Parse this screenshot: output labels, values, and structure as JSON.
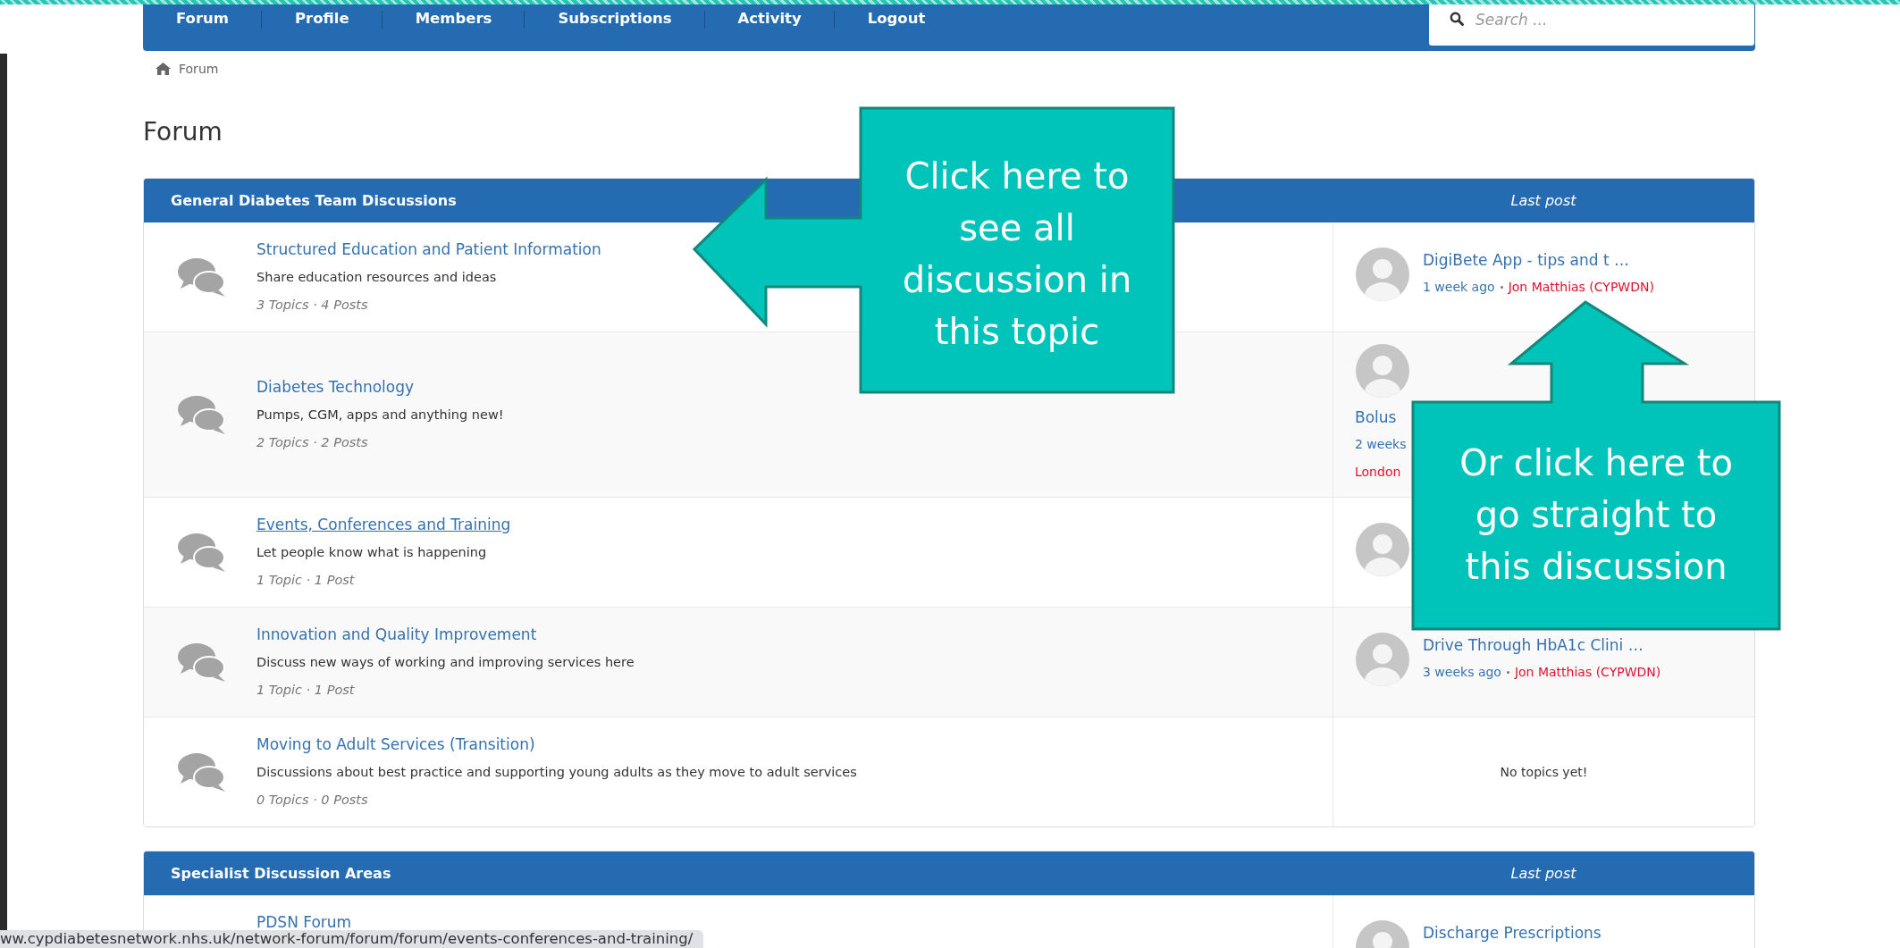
{
  "nav": {
    "items": [
      {
        "label": "Forum"
      },
      {
        "label": "Profile"
      },
      {
        "label": "Members"
      },
      {
        "label": "Subscriptions"
      },
      {
        "label": "Activity"
      },
      {
        "label": "Logout"
      }
    ],
    "search": {
      "placeholder": "Search ..."
    }
  },
  "breadcrumb": [
    {
      "label": "Forum"
    }
  ],
  "page_title": "Forum",
  "sections": [
    {
      "title": "General Diabetes Team Discussions",
      "last_post_heading": "Last post",
      "forums": [
        {
          "title": "Structured Education and Patient Information",
          "description": "Share education resources and ideas",
          "stats": "3 Topics · 4 Posts",
          "hovered": false,
          "last_post": {
            "kind": "post",
            "title": "DigiBete App - tips and t …",
            "time": "1 week ago",
            "author": "Jon Matthias (CYPWDN)"
          }
        },
        {
          "title": "Diabetes Technology",
          "description": "Pumps, CGM, apps and anything new!",
          "stats": "2 Topics · 2 Posts",
          "hovered": false,
          "last_post": {
            "kind": "stacked",
            "title": "Bolus",
            "time": "2 weeks",
            "author": "London"
          }
        },
        {
          "title": "Events, Conferences and Training",
          "description": "Let people know what is happening",
          "stats": "1 Topic · 1 Post",
          "hovered": true,
          "last_post": {
            "kind": "avatar"
          }
        },
        {
          "title": "Innovation and Quality Improvement",
          "description": "Discuss new ways of working and improving services here",
          "stats": "1 Topic · 1 Post",
          "hovered": false,
          "last_post": {
            "kind": "post",
            "title": "Drive Through HbA1c Clini …",
            "time": "3 weeks ago",
            "author": "Jon Matthias (CYPWDN)"
          }
        },
        {
          "title": "Moving to Adult Services (Transition)",
          "description": "Discussions about best practice and supporting young adults as they move to adult services",
          "stats": "0 Topics · 0 Posts",
          "hovered": false,
          "last_post": {
            "kind": "empty",
            "text": "No topics yet!"
          }
        }
      ]
    },
    {
      "title": "Specialist Discussion Areas",
      "last_post_heading": "Last post",
      "forums": [
        {
          "title": "PDSN Forum",
          "hovered": false,
          "last_post": {
            "kind": "post",
            "title": "Discharge Prescriptions"
          }
        }
      ]
    }
  ],
  "callouts": [
    {
      "kind": "left",
      "text": "Click here to see all discussion in this topic"
    },
    {
      "kind": "up",
      "text": "Or click here to go straight to this discussion"
    }
  ],
  "status_url": "ww.cypdiabetesnetwork.nhs.uk/network-forum/forum/forum/events-conferences-and-training/"
}
